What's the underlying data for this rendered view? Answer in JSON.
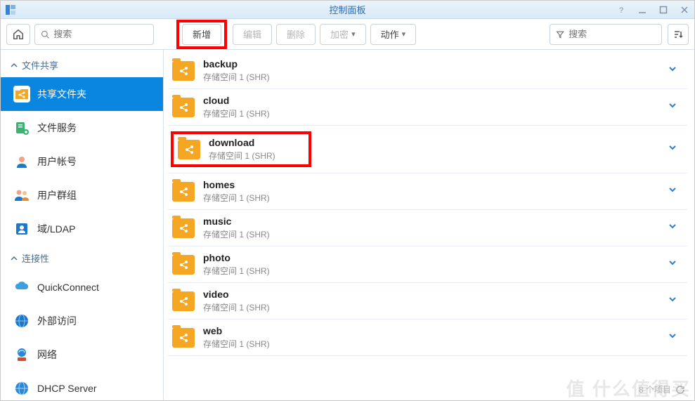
{
  "window": {
    "title": "控制面板"
  },
  "toolbar": {
    "search_placeholder": "搜索",
    "new": "新增",
    "edit": "编辑",
    "delete": "删除",
    "encrypt": "加密",
    "action": "动作",
    "filter_placeholder": "搜索"
  },
  "sidebar": {
    "cat_share": "文件共享",
    "cat_conn": "连接性",
    "items": [
      {
        "label": "共享文件夹"
      },
      {
        "label": "文件服务"
      },
      {
        "label": "用户帐号"
      },
      {
        "label": "用户群组"
      },
      {
        "label": "域/LDAP"
      },
      {
        "label": "QuickConnect"
      },
      {
        "label": "外部访问"
      },
      {
        "label": "网络"
      },
      {
        "label": "DHCP Server"
      }
    ]
  },
  "folders": [
    {
      "name": "backup",
      "sub": "存储空间 1 (SHR)"
    },
    {
      "name": "cloud",
      "sub": "存储空间 1 (SHR)"
    },
    {
      "name": "download",
      "sub": "存储空间 1 (SHR)"
    },
    {
      "name": "homes",
      "sub": "存储空间 1 (SHR)"
    },
    {
      "name": "music",
      "sub": "存储空间 1 (SHR)"
    },
    {
      "name": "photo",
      "sub": "存储空间 1 (SHR)"
    },
    {
      "name": "video",
      "sub": "存储空间 1 (SHR)"
    },
    {
      "name": "web",
      "sub": "存储空间 1 (SHR)"
    }
  ],
  "footer": {
    "count": "8 个项目"
  },
  "watermark": "值  什么值得买"
}
